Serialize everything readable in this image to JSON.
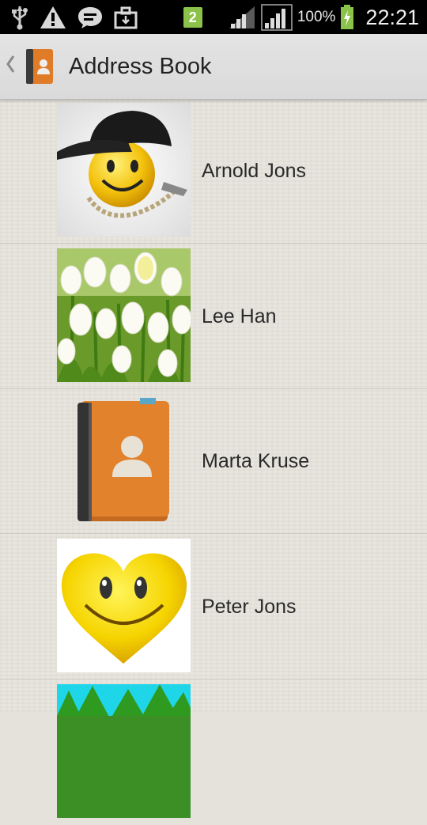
{
  "status_bar": {
    "icons": [
      "usb-icon",
      "warning-icon",
      "message-icon",
      "briefcase-icon"
    ],
    "sim_badge": "2",
    "battery_percent": "100%",
    "time": "22:21"
  },
  "action_bar": {
    "title": "Address Book",
    "up_icon": "chevron-left-icon",
    "app_icon": "address-book-icon"
  },
  "contacts": [
    {
      "name": "Arnold Jons",
      "avatar": "smiley-cap-photo"
    },
    {
      "name": "Lee Han",
      "avatar": "white-tulips-photo"
    },
    {
      "name": "Marta Kruse",
      "avatar": "address-book-icon"
    },
    {
      "name": "Peter Jons",
      "avatar": "smiley-heart-photo"
    },
    {
      "name": "",
      "avatar": "tree-photo"
    }
  ]
}
